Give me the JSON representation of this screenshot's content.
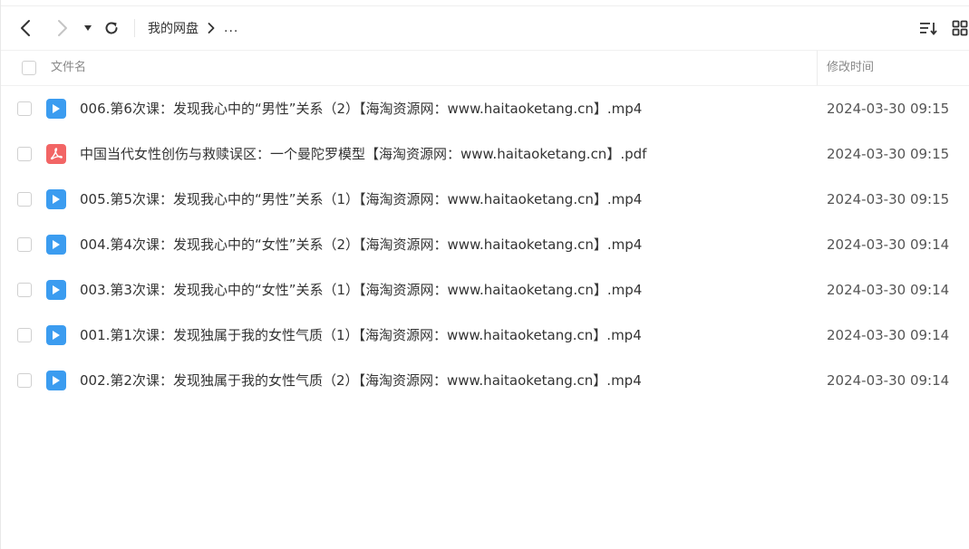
{
  "toolbar": {
    "breadcrumb_root": "我的网盘",
    "breadcrumb_more": "..."
  },
  "table": {
    "columns": {
      "name": "文件名",
      "modified": "修改时间"
    },
    "rows": [
      {
        "type": "video",
        "name": "006.第6次课：发现我心中的“男性”关系（2）【海淘资源网：www.haitaoketang.cn】.mp4",
        "time": "2024-03-30 09:15"
      },
      {
        "type": "pdf",
        "name": "中国当代女性创伤与救赎误区：一个曼陀罗模型【海淘资源网：www.haitaoketang.cn】.pdf",
        "time": "2024-03-30 09:15"
      },
      {
        "type": "video",
        "name": "005.第5次课：发现我心中的“男性”关系（1）【海淘资源网：www.haitaoketang.cn】.mp4",
        "time": "2024-03-30 09:15"
      },
      {
        "type": "video",
        "name": "004.第4次课：发现我心中的“女性”关系（2）【海淘资源网：www.haitaoketang.cn】.mp4",
        "time": "2024-03-30 09:14"
      },
      {
        "type": "video",
        "name": "003.第3次课：发现我心中的“女性”关系（1）【海淘资源网：www.haitaoketang.cn】.mp4",
        "time": "2024-03-30 09:14"
      },
      {
        "type": "video",
        "name": "001.第1次课：发现独属于我的女性气质（1）【海淘资源网：www.haitaoketang.cn】.mp4",
        "time": "2024-03-30 09:14"
      },
      {
        "type": "video",
        "name": "002.第2次课：发现独属于我的女性气质（2）【海淘资源网：www.haitaoketang.cn】.mp4",
        "time": "2024-03-30 09:14"
      }
    ]
  },
  "colors": {
    "video_icon": "#3b9cf0",
    "pdf_icon": "#f26565"
  },
  "icons": {
    "back": "chevron-left-icon",
    "forward": "chevron-right-icon",
    "dropdown": "caret-down-icon",
    "refresh": "refresh-icon",
    "separator": "chevron-right-icon",
    "sort": "sort-icon",
    "grid": "grid-view-icon",
    "video": "video-file-icon",
    "pdf": "pdf-file-icon"
  }
}
